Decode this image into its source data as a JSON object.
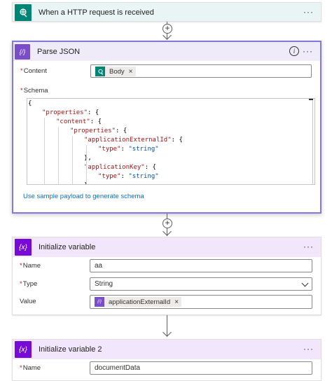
{
  "colors": {
    "trigger": "#008575",
    "parse_json": "#7a4dc9",
    "variable": "#770bd6",
    "selected_border": "#8378de",
    "link": "#0f6cbd"
  },
  "trigger": {
    "title": "When a HTTP request is received",
    "icon": "http-request-icon",
    "more": "···"
  },
  "parse_json": {
    "title": "Parse JSON",
    "icon": "braces-icon",
    "more": "···",
    "content_label": "Content",
    "content_token": "Body",
    "content_token_icon": "http-request-icon",
    "schema_label": "Schema",
    "required_mark": "*",
    "token_remove": "×",
    "schema_lines": [
      {
        "indent": 0,
        "text": "{"
      },
      {
        "indent": 1,
        "key": "\"properties\"",
        "rest": ": {"
      },
      {
        "indent": 2,
        "key": "\"content\"",
        "rest": ": {"
      },
      {
        "indent": 3,
        "key": "\"properties\"",
        "rest": ": {"
      },
      {
        "indent": 4,
        "key": "\"applicationExternalId\"",
        "rest": ": {"
      },
      {
        "indent": 5,
        "key": "\"type\"",
        "rest": ": ",
        "val": "\"string\""
      },
      {
        "indent": 4,
        "text": "},"
      },
      {
        "indent": 4,
        "key": "\"applicationKey\"",
        "rest": ": {"
      },
      {
        "indent": 5,
        "key": "\"type\"",
        "rest": ": ",
        "val": "\"string\""
      },
      {
        "indent": 4,
        "text": "},"
      }
    ],
    "sample_link": "Use sample payload to generate schema"
  },
  "init_var": {
    "title": "Initialize variable",
    "icon": "variable-icon",
    "more": "···",
    "name_label": "Name",
    "name_value": "aa",
    "type_label": "Type",
    "type_value": "String",
    "value_label": "Value",
    "value_token": "applicationExternalId",
    "value_token_icon": "braces-icon",
    "required_mark": "*",
    "token_remove": "×"
  },
  "init_var2": {
    "title": "Initialize variable 2",
    "icon": "variable-icon",
    "more": "···",
    "name_label": "Name",
    "name_value": "documentData",
    "required_mark": "*"
  },
  "connectors": {
    "plus_label": "+"
  },
  "info_label": "i"
}
